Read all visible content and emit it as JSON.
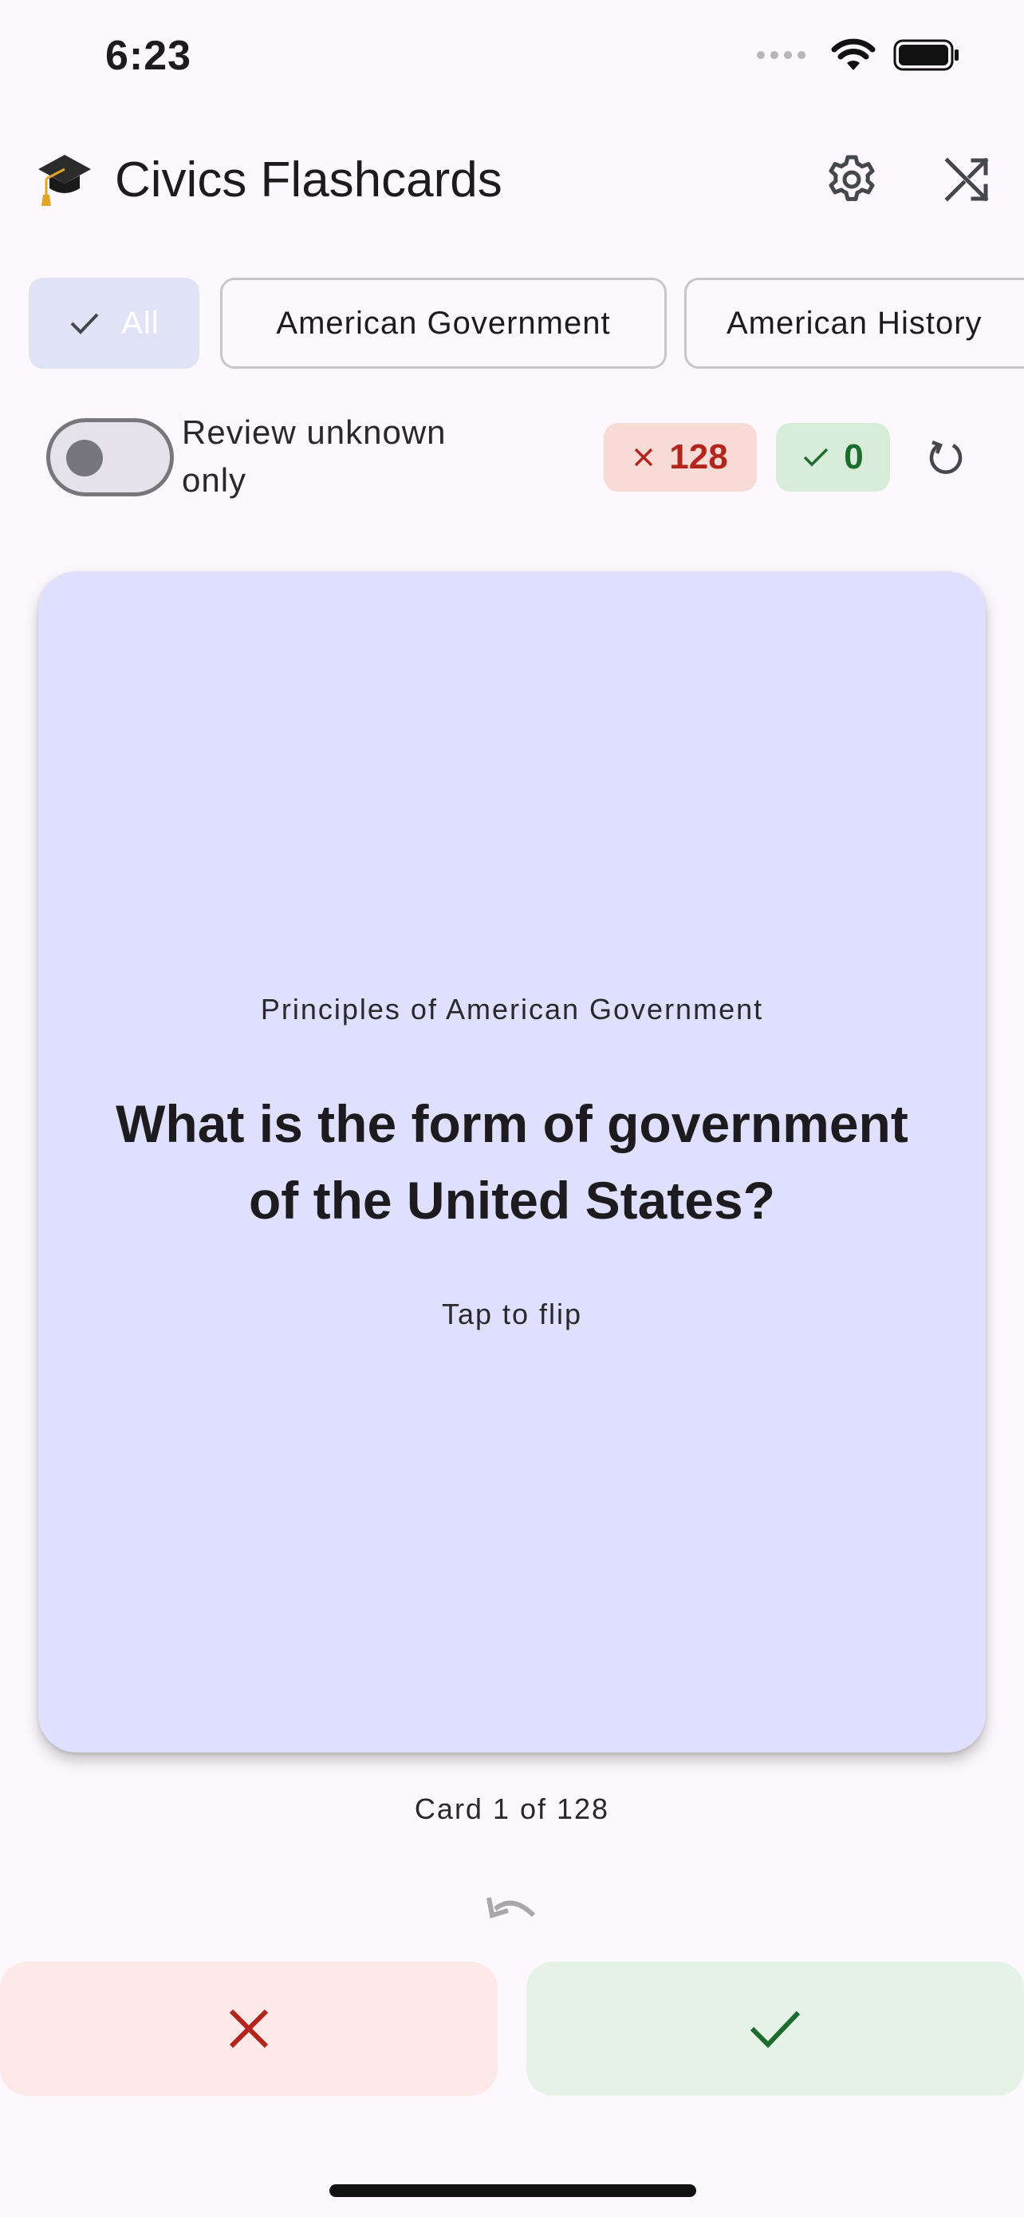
{
  "status_bar": {
    "time": "6:23",
    "icons": [
      "signal-dots-icon",
      "wifi-icon",
      "battery-icon"
    ]
  },
  "app_bar": {
    "logo_icon": "graduation-cap-icon",
    "title": "Civics Flashcards",
    "actions": [
      "settings-icon",
      "shuffle-icon"
    ]
  },
  "filters": {
    "chips": [
      {
        "label": "All",
        "selected": true
      },
      {
        "label": "American Government",
        "selected": false
      },
      {
        "label": "American History",
        "selected": false
      }
    ]
  },
  "review": {
    "toggle_label": "Review unknown only",
    "toggle_on": false,
    "unknown_count": "128",
    "known_count": "0"
  },
  "card": {
    "category": "Principles of American Government",
    "question": "What is the form of government of the United States?",
    "hint": "Tap to flip",
    "counter": "Card 1 of 128"
  },
  "colors": {
    "background": "#FCF8FD",
    "card": "#DEE0FD",
    "unknown_accent": "#B3261E",
    "known_accent": "#1D6B2D",
    "unknown_button_bg": "#FCE9E8",
    "known_button_bg": "#E5F3E6"
  },
  "actions": {
    "unknown_button_icon": "close-icon",
    "known_button_icon": "check-icon",
    "undo_icon": "undo-icon"
  }
}
